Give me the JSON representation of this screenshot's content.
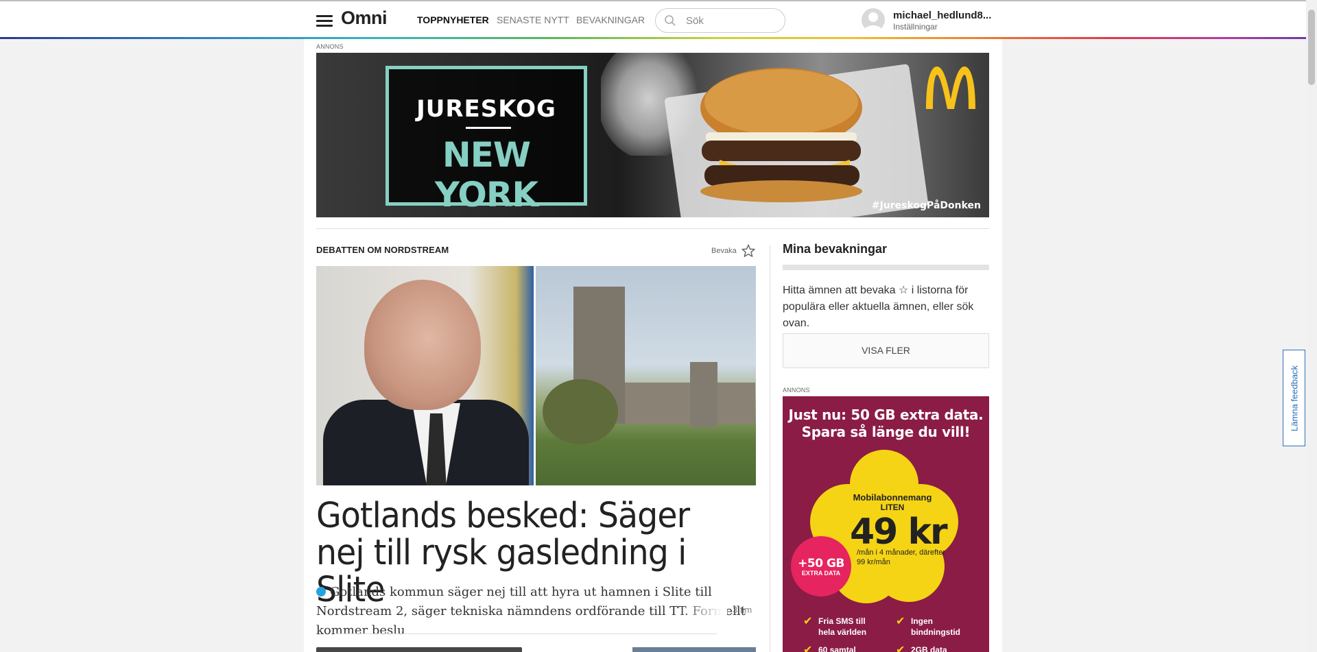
{
  "header": {
    "logo": "Omni",
    "nav": [
      {
        "label": "TOPPNYHETER",
        "active": true
      },
      {
        "label": "SENASTE NYTT",
        "active": false
      },
      {
        "label": "BEVAKNINGAR",
        "active": false
      }
    ],
    "search": {
      "placeholder": "Sök",
      "icon": "search-icon"
    },
    "user": {
      "name": "michael_hedlund8...",
      "settings": "Inställningar"
    }
  },
  "top_ad": {
    "label": "ANNONS",
    "line1": "JURESKOG",
    "line2": "NEW YORK",
    "hashtag": "#JureskogPåDonken",
    "brand_icon": "mcdonalds-logo",
    "accent": "#86cfc3"
  },
  "article": {
    "topic": "DEBATTEN OM NORDSTREAM",
    "follow_label": "Bevaka",
    "headline": "Gotlands besked: Säger nej till rysk gasledning i Slite",
    "lede": "Gotlands kommun säger nej till att hyra ut hamnen i Slite till Nordstream 2, säger tekniska nämndens ordförande till TT. Formellt kommer beslu",
    "time": "3 tim",
    "dot_color": "#27a3dc"
  },
  "sidebar": {
    "title": "Mina bevakningar",
    "help_text": "Hitta ämnen att bevaka ☆ i listorna för populära eller aktuella ämnen, eller sök ovan.",
    "more_button": "VISA FLER",
    "ad": {
      "label": "ANNONS",
      "headline_1": "Just nu: 50 GB extra data.",
      "headline_2": "Spara så länge du vill!",
      "plan_1": "Mobilabonnemang",
      "plan_2": "LITEN",
      "price": "49 kr",
      "terms": "/mån i 4 månader, därefter 99 kr/mån",
      "badge_1": "+50 GB",
      "badge_2": "EXTRA DATA",
      "features": [
        "Fria SMS till hela världen",
        "Ingen bindningstid",
        "60 samtal",
        "2GB data"
      ],
      "bg_color": "#8b1c45",
      "yellow": "#f5d415",
      "pink": "#e6245f"
    }
  },
  "feedback_tab": "Lämna feedback"
}
